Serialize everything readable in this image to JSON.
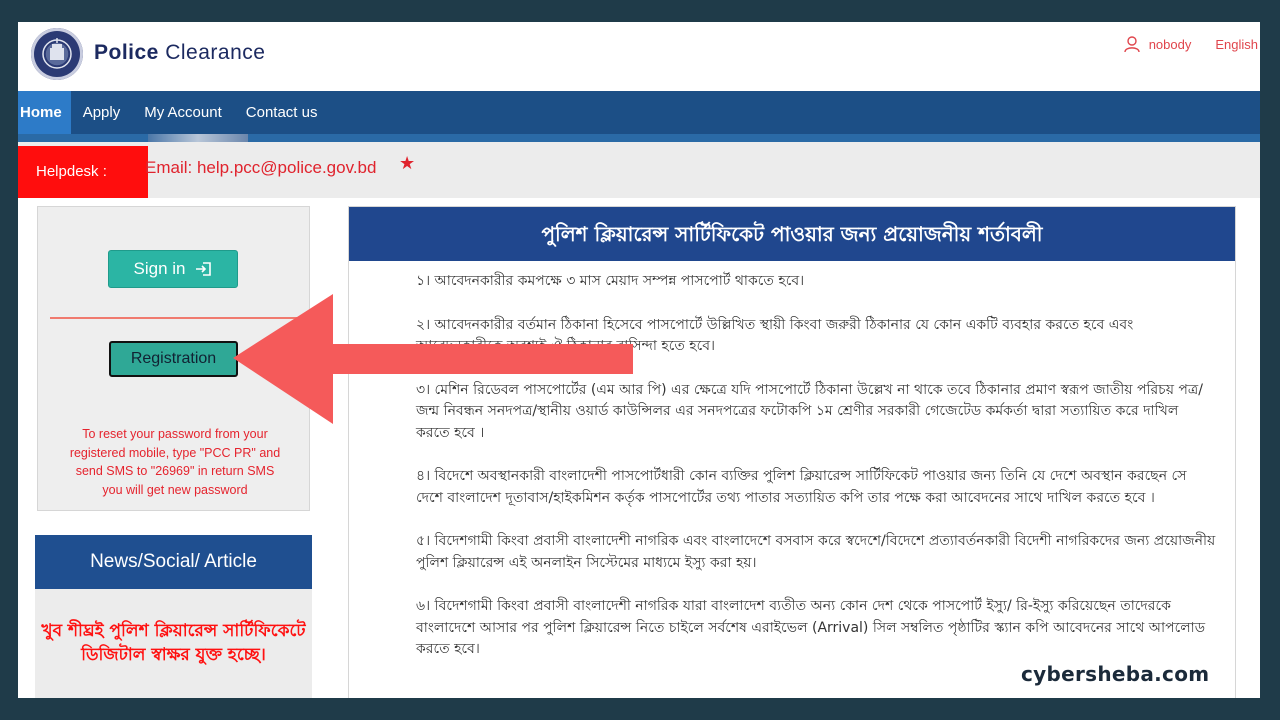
{
  "header": {
    "brand_bold": "Police",
    "brand_rest": "Clearance",
    "user_name": "nobody",
    "language": "English"
  },
  "nav": {
    "items": [
      {
        "label": "Home",
        "active": true
      },
      {
        "label": "Apply",
        "active": false
      },
      {
        "label": "My Account",
        "active": false
      },
      {
        "label": "Contact us",
        "active": false
      }
    ]
  },
  "helpdesk": {
    "label": "Helpdesk :",
    "text": "Email: help.pcc@police.gov.bd",
    "star": "★"
  },
  "left_panel": {
    "signin_label": "Sign in",
    "registration_label": "Registration",
    "reset_text": "To reset your password from your registered mobile, type \"PCC PR\" and send SMS to \"26969\" in return SMS you will get new password"
  },
  "news": {
    "heading": "News/Social/ Article",
    "text": "খুব শীঘ্রই পুলিশ ক্লিয়ারেন্স সার্টিফিকেটে ডিজিটাল স্বাক্ষর যুক্ত হচ্ছে।"
  },
  "main": {
    "heading": "পুলিশ ক্লিয়ারেন্স সার্টিফিকেট পাওয়ার জন্য প্রয়োজনীয় শর্তাবলী",
    "terms": [
      "১। আবেদনকারীর কমপক্ষে ৩ মাস মেয়াদ সম্পন্ন পাসপোর্ট থাকতে হবে।",
      "২। আবেদনকারীর বর্তমান ঠিকানা হিসেবে পাসপোর্টে উল্লিখিত স্থায়ী কিংবা জরুরী ঠিকানার যে কোন একটি ব্যবহার করতে হবে এবং আবেদনকারীকে অবশ্যই ঐ ঠিকানার বাসিন্দা হতে হবে।",
      "৩। মেশিন রিডেবল পাসপোর্টের (এম আর পি) এর ক্ষেত্রে যদি পাসপোর্টে ঠিকানা উল্লেখ না থাকে তবে ঠিকানার প্রমাণ স্বরূপ জাতীয় পরিচয় পত্র/জন্ম নিবন্ধন সনদপত্র/স্থানীয় ওয়ার্ড কাউন্সিলর এর সনদপত্রের ফটোকপি ১ম শ্রেণীর সরকারী গেজেটেড কর্মকর্তা দ্বারা সত্যায়িত করে দাখিল করতে হবে ।",
      "৪। বিদেশে অবস্থানকারী বাংলাদেশী পাসপোর্টধারী কোন ব্যক্তির পুলিশ ক্লিয়ারেন্স সার্টিফিকেট পাওয়ার জন্য তিনি যে দেশে অবস্থান করছেন সে দেশে বাংলাদেশ দূতাবাস/হাইকমিশন কর্তৃক পাসপোর্টের তথ্য পাতার সত্যায়িত কপি তার পক্ষে করা আবেদনের সাথে দাখিল করতে হবে ।",
      "৫। বিদেশগামী কিংবা প্রবাসী বাংলাদেশী নাগরিক এবং বাংলাদেশে বসবাস করে স্বদেশে/বিদেশে প্রত্যাবর্তনকারী বিদেশী নাগরিকদের জন্য প্রয়োজনীয় পুলিশ ক্লিয়ারেন্স এই অনলাইন সিস্টেমের মাধ্যমে ইস্যু করা হয়।",
      "৬। বিদেশগামী কিংবা প্রবাসী বাংলাদেশী নাগরিক যারা বাংলাদেশ ব্যতীত অন্য কোন দেশ থেকে পাসপোর্ট ইস্যু/ রি-ইস্যু করিয়েছেন তাদেরকে বাংলাদেশে আসার পর পুলিশ ক্লিয়ারেন্স নিতে চাইলে সর্বশেষ এরাইভেল (Arrival) সিল সম্বলিত পৃষ্ঠাটির স্ক্যান কপি আবেদনের সাথে আপলোড করতে হবে।"
    ]
  },
  "watermark": "cybersheba.com",
  "colors": {
    "nav_bg": "#1c4f86",
    "nav_active": "#2d7bc8",
    "helpdesk_red": "#ff0d0d",
    "button_teal": "#2bb5a4",
    "heading_blue": "#20478e",
    "arrow": "#f55a5a"
  }
}
